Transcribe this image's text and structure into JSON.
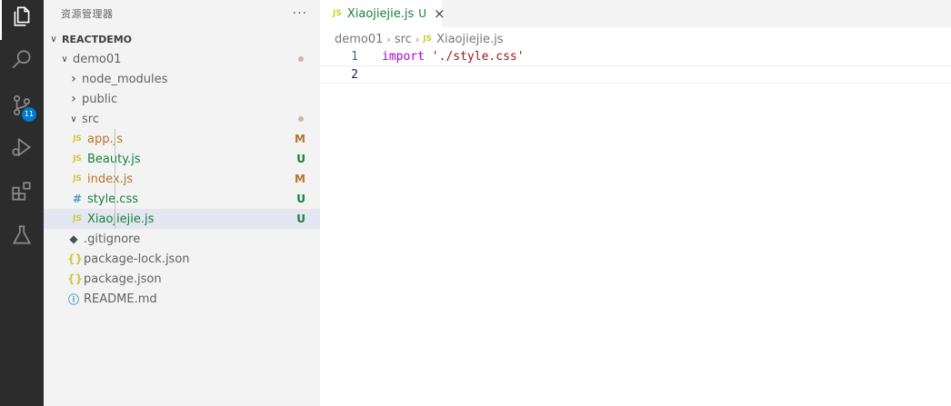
{
  "colors": {
    "modified": "#b5752e",
    "untracked": "#1a7f37",
    "js_icon": "#cbcb41",
    "css_icon": "#519aba",
    "json_icon": "#cbcb41",
    "git_icon": "#41535b",
    "info_icon": "#519aba",
    "accent": "#007acc"
  },
  "activity_bar": {
    "items": [
      {
        "icon": "files-icon",
        "active": true
      },
      {
        "icon": "search-icon"
      },
      {
        "icon": "source-control-icon",
        "badge": "11"
      },
      {
        "icon": "run-debug-icon"
      },
      {
        "icon": "extensions-icon"
      },
      {
        "icon": "testing-icon"
      }
    ]
  },
  "sidebar": {
    "title": "资源管理器",
    "more": "···",
    "root": "REACTDEMO",
    "tree": [
      {
        "name": "demo01",
        "type": "folder",
        "expanded": true,
        "depth": 1,
        "dot": true
      },
      {
        "name": "node_modules",
        "type": "folder",
        "expanded": false,
        "depth": 2
      },
      {
        "name": "public",
        "type": "folder",
        "expanded": false,
        "depth": 2
      },
      {
        "name": "src",
        "type": "folder",
        "expanded": true,
        "depth": 2,
        "dot": true
      },
      {
        "name": "app.js",
        "type": "js",
        "icon_text": "JS",
        "depth": 3,
        "status": "M"
      },
      {
        "name": "Beauty.js",
        "type": "js",
        "icon_text": "JS",
        "depth": 3,
        "status": "U"
      },
      {
        "name": "index.js",
        "type": "js",
        "icon_text": "JS",
        "depth": 3,
        "status": "M"
      },
      {
        "name": "style.css",
        "type": "css",
        "icon_text": "#",
        "depth": 3,
        "status": "U"
      },
      {
        "name": "Xiaojiejie.js",
        "type": "js",
        "icon_text": "JS",
        "depth": 3,
        "status": "U",
        "selected": true
      },
      {
        "name": ".gitignore",
        "type": "git",
        "icon_text": "◆",
        "depth": 2
      },
      {
        "name": "package-lock.json",
        "type": "json",
        "icon_text": "{}",
        "depth": 2
      },
      {
        "name": "package.json",
        "type": "json",
        "icon_text": "{}",
        "depth": 2
      },
      {
        "name": "README.md",
        "type": "info",
        "icon_text": "ⓘ",
        "depth": 2
      }
    ]
  },
  "editor": {
    "tab": {
      "icon_text": "JS",
      "label": "Xiaojiejie.js",
      "status": "U",
      "close": "×"
    },
    "breadcrumb": {
      "folder1": "demo01",
      "folder2": "src",
      "file_icon": "JS",
      "file": "Xiaojiejie.js",
      "separator": "›"
    },
    "lines": [
      {
        "num": "1",
        "keyword": "import",
        "string": "'./style.css'"
      },
      {
        "num": "2",
        "keyword": "",
        "string": ""
      }
    ]
  }
}
